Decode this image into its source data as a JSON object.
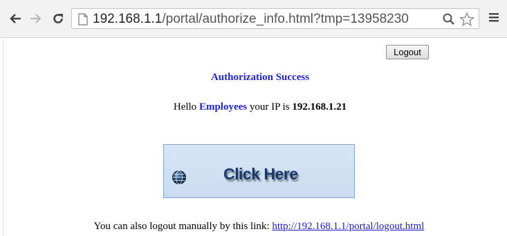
{
  "browser": {
    "url_host": "192.168.1.1",
    "url_path": "/portal/authorize_info.html?tmp=13958230",
    "icons": {
      "back": "back-arrow-icon",
      "forward": "forward-arrow-icon",
      "reload": "reload-icon",
      "page": "page-icon",
      "zoom": "zoom-icon",
      "bookmark": "star-icon",
      "menu": "hamburger-menu-icon"
    }
  },
  "page": {
    "logout_label": "Logout",
    "auth_title": "Authorization Success",
    "hello_prefix": "Hello",
    "user_group": "Employees",
    "ip_prefix": "your IP is",
    "ip_address": "192.168.1.21",
    "click_label": "Click Here",
    "manual_text": "You can also logout manually by this link:",
    "logout_link": "http://192.168.1.1/portal/logout.html"
  },
  "colors": {
    "accent_text": "#2323d8",
    "link": "#1b1bd1",
    "button_bg": "#d7e6f6",
    "button_text": "#17376e"
  }
}
